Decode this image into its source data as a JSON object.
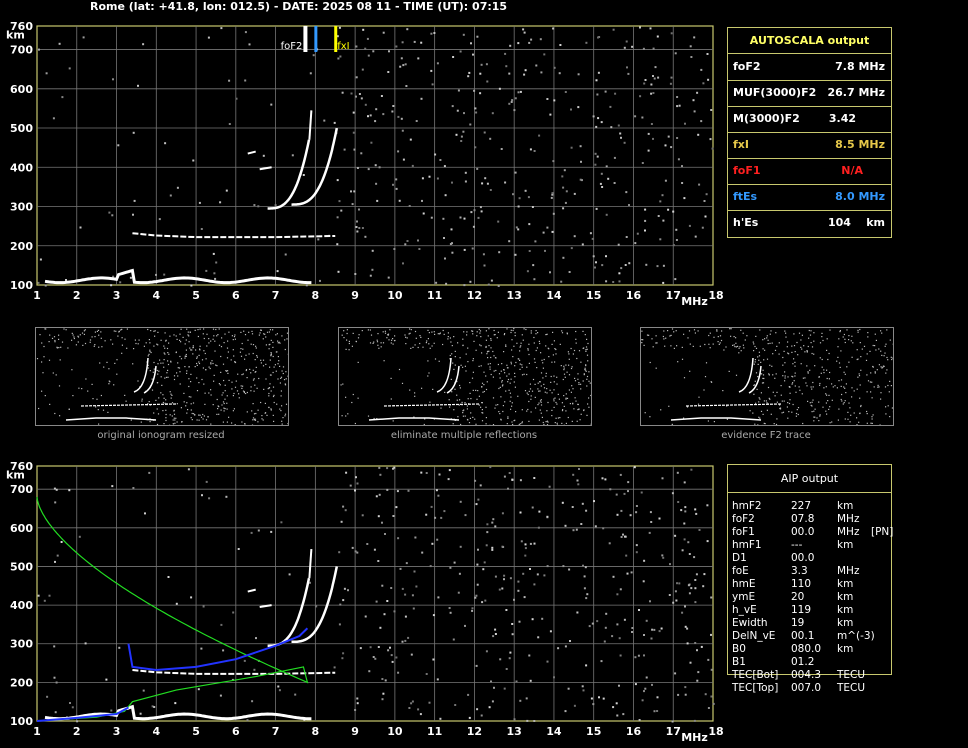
{
  "header": {
    "title": "Rome (lat: +41.8, lon: 012.5) - DATE: 2025 08 11 - TIME (UT): 07:15"
  },
  "axes": {
    "y_ticks": [
      "760",
      "700",
      "600",
      "500",
      "400",
      "300",
      "200",
      "100"
    ],
    "y_unit": "km",
    "x_ticks": [
      "1",
      "2",
      "3",
      "4",
      "5",
      "6",
      "7",
      "8",
      "9",
      "10",
      "11",
      "12",
      "13",
      "14",
      "15",
      "16",
      "17",
      "18"
    ],
    "x_unit": "MHz"
  },
  "markers": {
    "fof2_label": "foF2",
    "fxi_label": "fxI",
    "fxi_color": "#ffff00",
    "fof2_color": "#3399ff"
  },
  "autoscala": {
    "title": "AUTOSCALA output",
    "rows": [
      {
        "label": "foF2",
        "value": "7.8 MHz",
        "color": "#ffffff"
      },
      {
        "label": "MUF(3000)F2",
        "value": "26.7 MHz",
        "color": "#ffffff"
      },
      {
        "label": "M(3000)F2",
        "value": "3.42",
        "color": "#ffffff"
      },
      {
        "label": "fxI",
        "value": "8.5 MHz",
        "color": "#e6c84a"
      },
      {
        "label": "foF1",
        "value": "N/A",
        "color": "#ff2020"
      },
      {
        "label": "ftEs",
        "value": "8.0 MHz",
        "color": "#3399ff"
      },
      {
        "label": "h'Es",
        "value": "104    km",
        "color": "#ffffff"
      }
    ]
  },
  "thumbnails": [
    {
      "caption": "original ionogram resized"
    },
    {
      "caption": "eliminate multiple reflections"
    },
    {
      "caption": "evidence F2 trace"
    }
  ],
  "aip": {
    "title": "AIP output",
    "rows": [
      {
        "name": "hmF2",
        "value": "227",
        "unit": "km",
        "extra": ""
      },
      {
        "name": "foF2",
        "value": "07.8",
        "unit": "MHz",
        "extra": ""
      },
      {
        "name": "foF1",
        "value": "00.0",
        "unit": "MHz",
        "extra": "[PN]"
      },
      {
        "name": "hmF1",
        "value": "---",
        "unit": "km",
        "extra": ""
      },
      {
        "name": "D1",
        "value": "00.0",
        "unit": "",
        "extra": ""
      },
      {
        "name": "foE",
        "value": "3.3",
        "unit": "MHz",
        "extra": ""
      },
      {
        "name": "hmE",
        "value": "110",
        "unit": "km",
        "extra": ""
      },
      {
        "name": "ymE",
        "value": "20",
        "unit": "km",
        "extra": ""
      },
      {
        "name": "h_vE",
        "value": "119",
        "unit": "km",
        "extra": ""
      },
      {
        "name": "Ewidth",
        "value": "19",
        "unit": "km",
        "extra": ""
      },
      {
        "name": "DelN_vE",
        "value": "00.1",
        "unit": "m^(-3)",
        "extra": ""
      },
      {
        "name": "B0",
        "value": "080.0",
        "unit": "km",
        "extra": ""
      },
      {
        "name": "B1",
        "value": "01.2",
        "unit": "",
        "extra": ""
      },
      {
        "name": "TEC[Bot]",
        "value": "004.3",
        "unit": "TECU",
        "extra": ""
      },
      {
        "name": "TEC[Top]",
        "value": "007.0",
        "unit": "TECU",
        "extra": ""
      }
    ]
  }
}
